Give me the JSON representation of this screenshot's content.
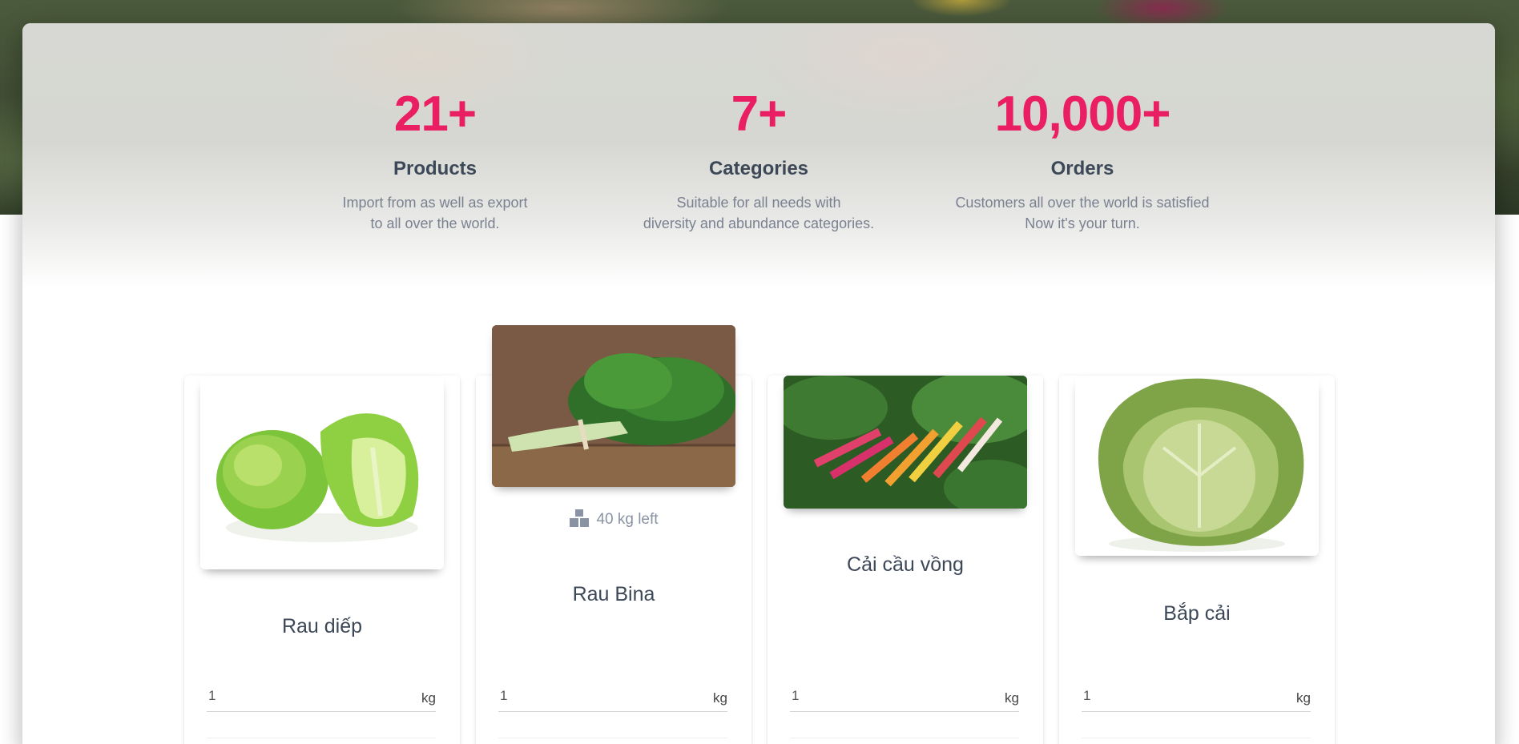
{
  "stats": [
    {
      "number": "21+",
      "label": "Products",
      "desc_line1": "Import from as well as export",
      "desc_line2": "to all over the world."
    },
    {
      "number": "7+",
      "label": "Categories",
      "desc_line1": "Suitable for all needs with",
      "desc_line2": "diversity and abundance categories."
    },
    {
      "number": "10,000+",
      "label": "Orders",
      "desc_line1": "Customers all over the world is satisfied",
      "desc_line2": "Now it's your turn."
    }
  ],
  "products": [
    {
      "name": "Rau diếp",
      "quantity": "1",
      "unit": "kg",
      "image_icon": "lettuce-image"
    },
    {
      "name": "Rau Bina",
      "quantity": "1",
      "unit": "kg",
      "stock": "40 kg left",
      "image_icon": "spinach-image"
    },
    {
      "name": "Cải cầu vồng",
      "quantity": "1",
      "unit": "kg",
      "image_icon": "rainbow-chard-image"
    },
    {
      "name": "Bắp cải",
      "quantity": "1",
      "unit": "kg",
      "image_icon": "cabbage-image"
    }
  ],
  "colors": {
    "accent": "#e91e63",
    "heading": "#3c4858",
    "muted": "#7a8190"
  }
}
